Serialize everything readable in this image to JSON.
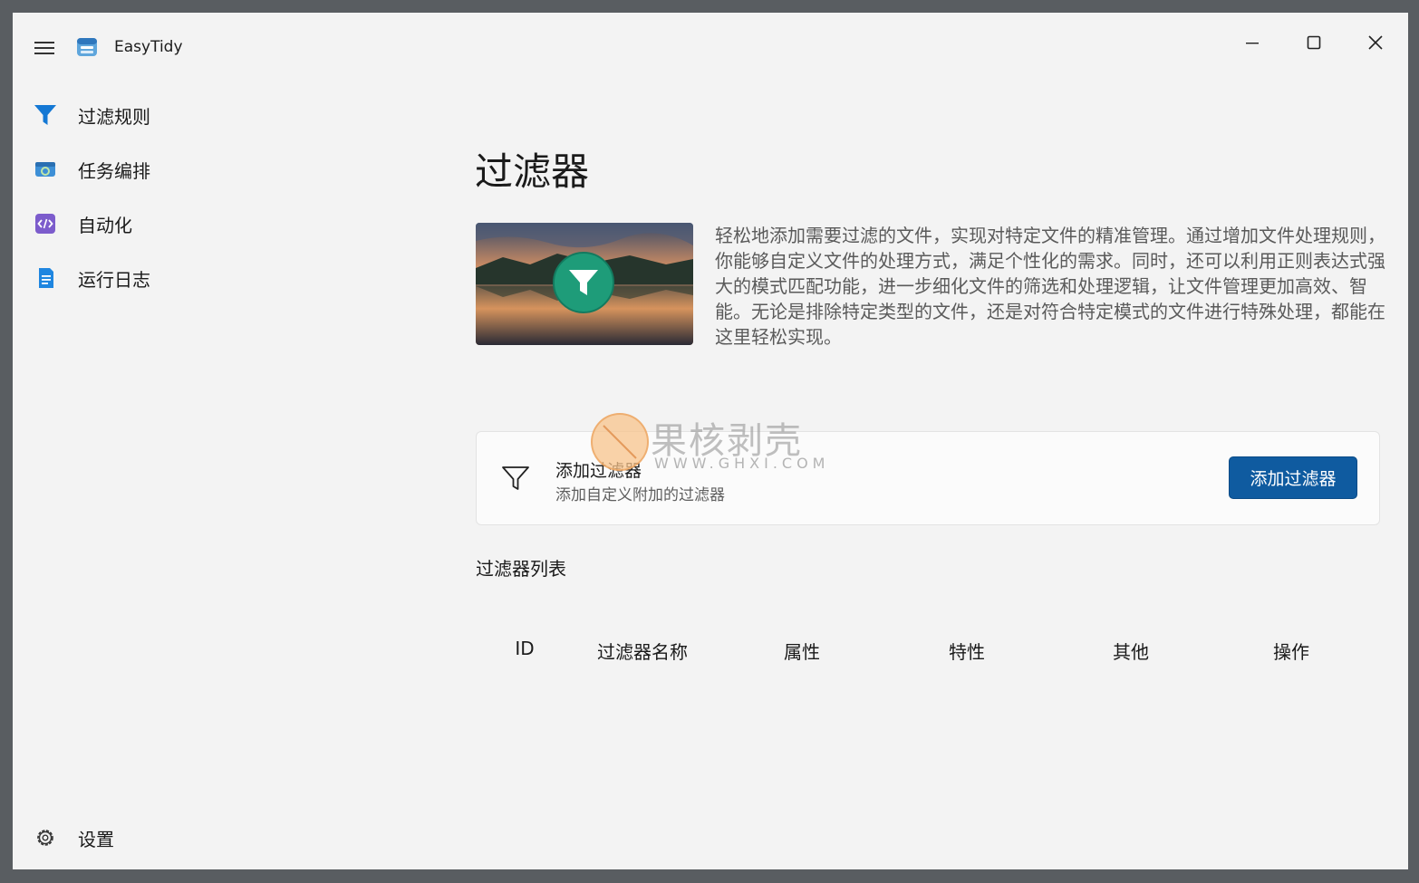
{
  "app": {
    "title": "EasyTidy"
  },
  "window_controls": {
    "minimize_icon": "minimize-icon",
    "maximize_icon": "maximize-icon",
    "close_icon": "close-icon"
  },
  "sidebar": {
    "items": [
      {
        "label": "过滤规则",
        "icon": "filter-icon",
        "selected": true
      },
      {
        "label": "任务编排",
        "icon": "task-icon"
      },
      {
        "label": "自动化",
        "icon": "code-icon"
      },
      {
        "label": "运行日志",
        "icon": "log-icon"
      }
    ],
    "settings": {
      "label": "设置",
      "icon": "gear-icon"
    }
  },
  "main": {
    "title": "过滤器",
    "description": "轻松地添加需要过滤的文件，实现对特定文件的精准管理。通过增加文件处理规则，你能够自定义文件的处理方式，满足个性化的需求。同时，还可以利用正则表达式强大的模式匹配功能，进一步细化文件的筛选和处理逻辑，让文件管理更加高效、智能。无论是排除特定类型的文件，还是对符合特定模式的文件进行特殊处理，都能在这里轻松实现。",
    "add_card": {
      "title": "添加过滤器",
      "subtitle": "添加自定义附加的过滤器",
      "button_label": "添加过滤器"
    },
    "list_title": "过滤器列表",
    "table_headers": [
      "ID",
      "过滤器名称",
      "属性",
      "特性",
      "其他",
      "操作"
    ]
  },
  "watermark": {
    "text": "果核剥壳",
    "sub": "WWW.GHXI.COM"
  },
  "colors": {
    "accent": "#0f5ba0",
    "background": "#f3f3f3",
    "frame": "#595d61"
  }
}
